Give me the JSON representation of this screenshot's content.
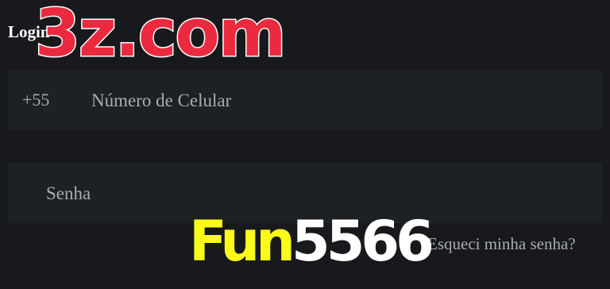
{
  "login": {
    "title": "Login"
  },
  "phone": {
    "prefix": "+55",
    "placeholder": "Número de Celular"
  },
  "password": {
    "placeholder": "Senha"
  },
  "forgot": {
    "label": "Esqueci minha senha?"
  },
  "watermark": {
    "top": "3z.com",
    "bottom_a": "Fun",
    "bottom_b": "5566"
  },
  "colors": {
    "background": "#17191c",
    "field": "#1d2024",
    "watermark_red": "#ec2a3f",
    "watermark_yellow": "#fbfb19"
  }
}
